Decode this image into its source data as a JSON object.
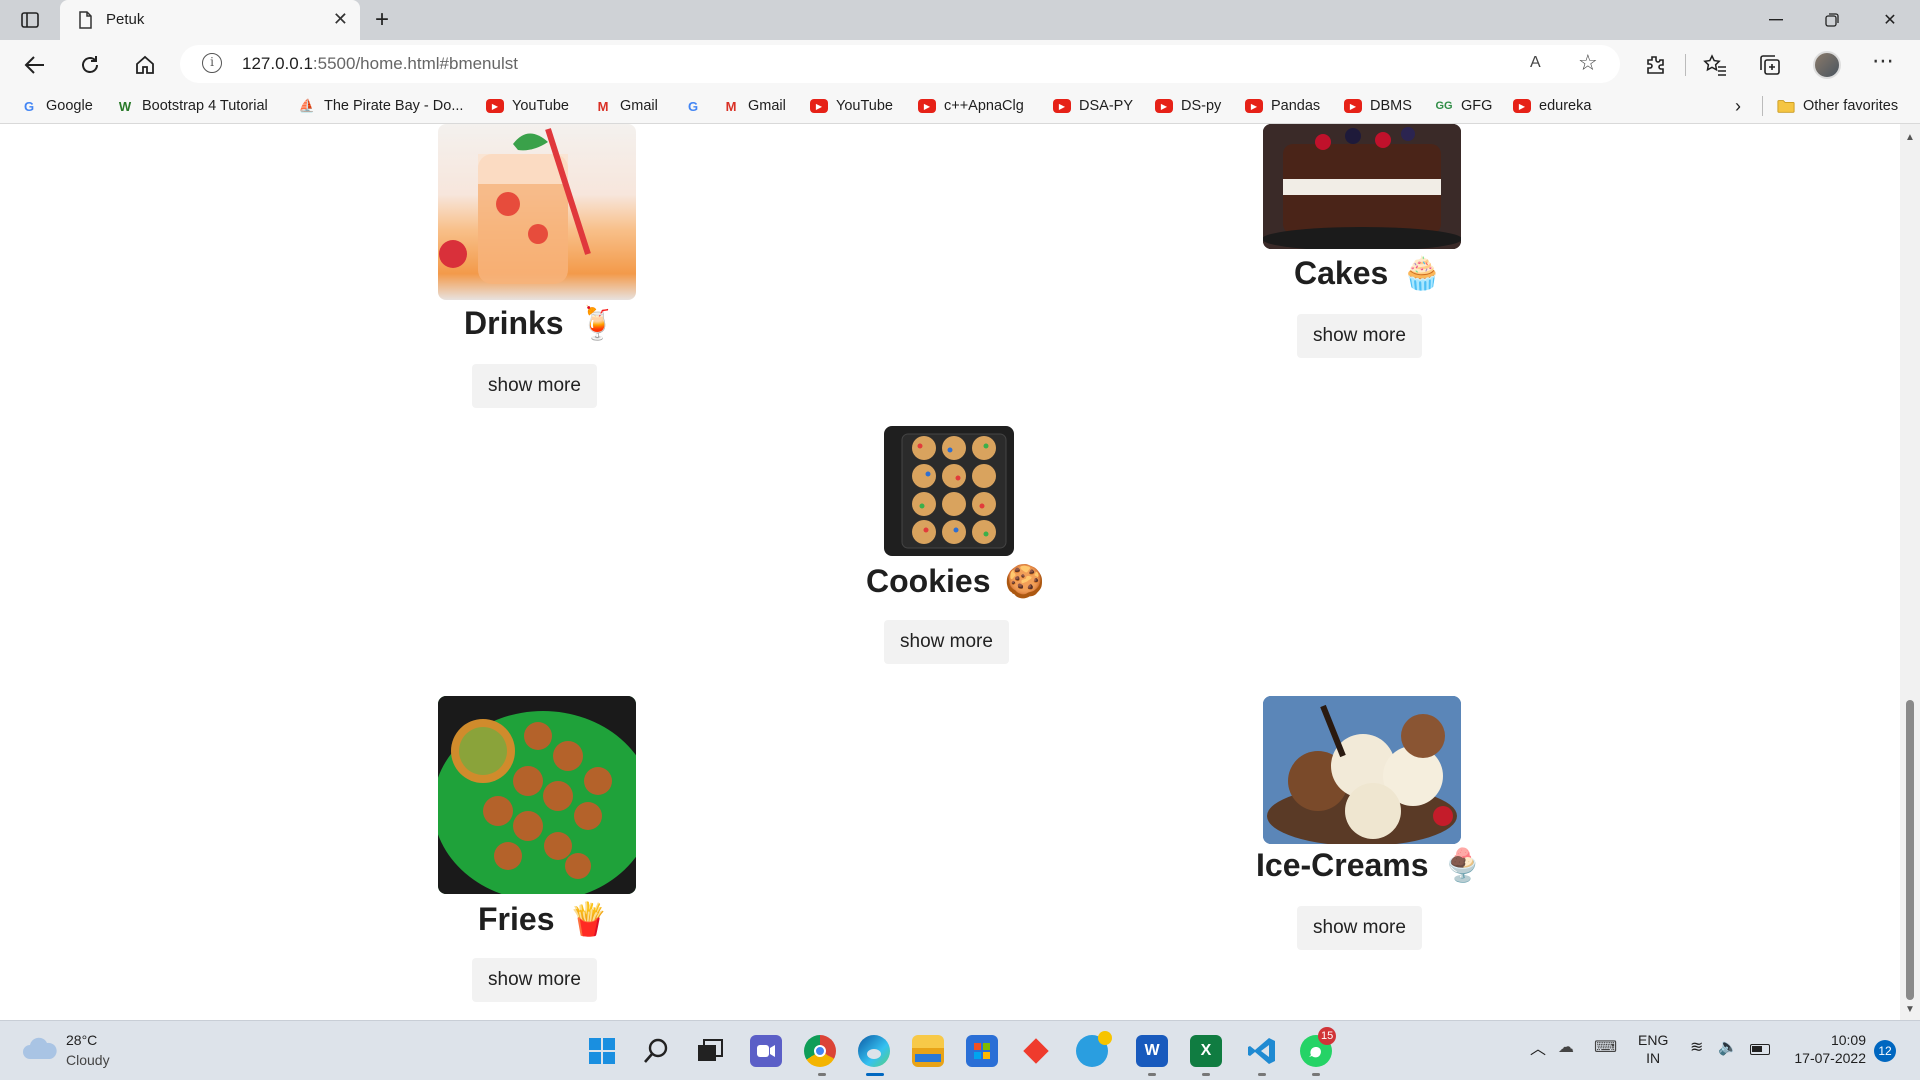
{
  "browser": {
    "tab_title": "Petuk",
    "url_host": "127.0.0.1",
    "url_path": ":5500/home.html#bmenulst",
    "bookmarks": [
      {
        "label": "Google",
        "icon": "google-icon"
      },
      {
        "label": "Bootstrap 4 Tutorial",
        "icon": "w3-icon"
      },
      {
        "label": "The Pirate Bay - Do...",
        "icon": "pirate-ship-icon"
      },
      {
        "label": "YouTube",
        "icon": "youtube-icon"
      },
      {
        "label": "Gmail",
        "icon": "gmail-icon"
      },
      {
        "label": "",
        "icon": "google-icon"
      },
      {
        "label": "Gmail",
        "icon": "gmail-icon"
      },
      {
        "label": "YouTube",
        "icon": "youtube-icon"
      },
      {
        "label": "c++ApnaClg",
        "icon": "youtube-icon"
      },
      {
        "label": "DSA-PY",
        "icon": "youtube-icon"
      },
      {
        "label": "DS-py",
        "icon": "youtube-icon"
      },
      {
        "label": "Pandas",
        "icon": "youtube-icon"
      },
      {
        "label": "DBMS",
        "icon": "youtube-icon"
      },
      {
        "label": "GFG",
        "icon": "gfg-icon"
      },
      {
        "label": "edureka",
        "icon": "youtube-icon"
      }
    ],
    "other_favorites": "Other favorites"
  },
  "menu": {
    "items": [
      {
        "title": "Drinks",
        "emoji": "🍹",
        "button": "show more"
      },
      {
        "title": "Cakes",
        "emoji": "🧁",
        "button": "show more"
      },
      {
        "title": "Cookies",
        "emoji": "🍪",
        "button": "show more"
      },
      {
        "title": "Fries",
        "emoji": "🍟",
        "button": "show more"
      },
      {
        "title": "Ice-Creams",
        "emoji": "🍨",
        "button": "show more"
      }
    ]
  },
  "taskbar": {
    "weather_temp": "28°C",
    "weather_desc": "Cloudy",
    "whatsapp_badge": "15",
    "lang_line1": "ENG",
    "lang_line2": "IN",
    "time": "10:09",
    "date": "17-07-2022",
    "notification_count": "12"
  }
}
